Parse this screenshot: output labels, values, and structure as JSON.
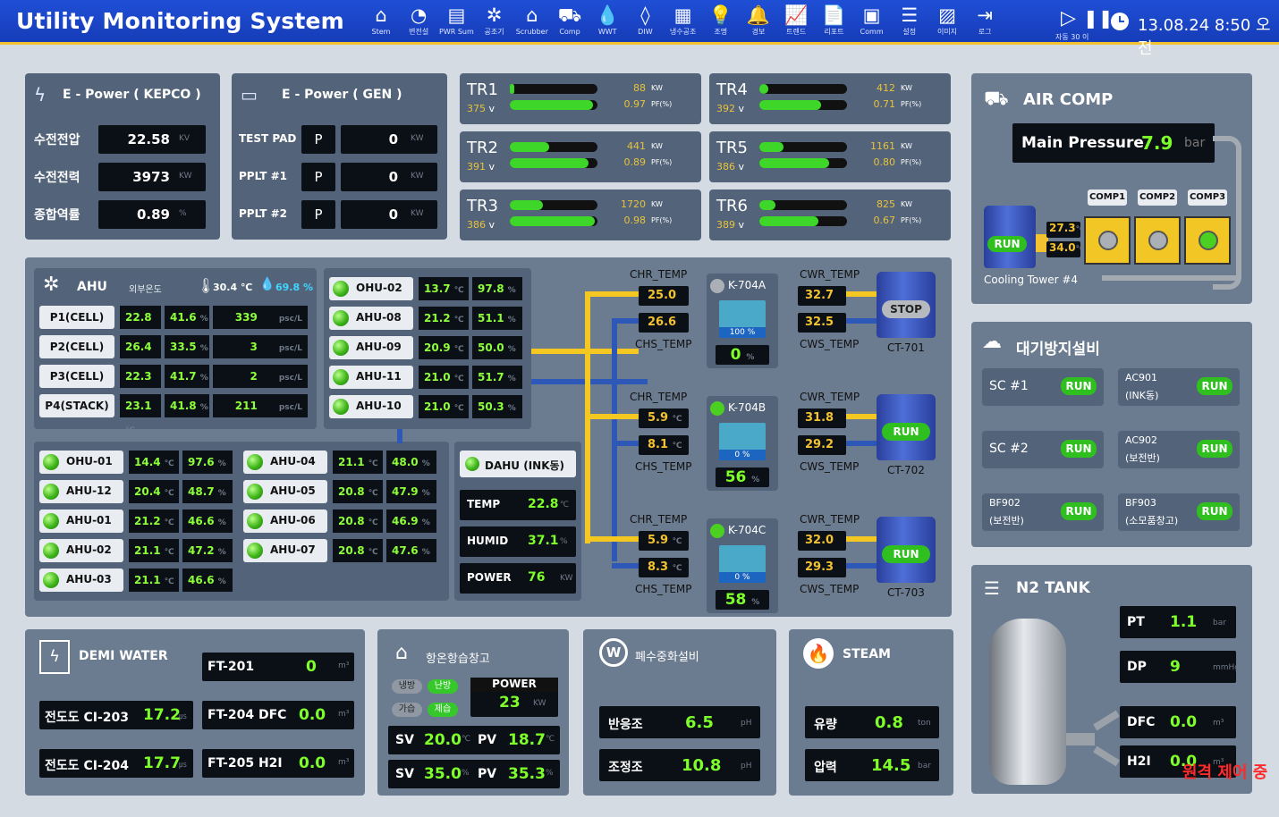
{
  "header": {
    "title": "Utility Monitoring System",
    "datetime": "13.08.24  8:50 오전",
    "nav": [
      {
        "icon": "home-icon",
        "glyph": "⌂",
        "label": "Stem"
      },
      {
        "icon": "gauge-icon",
        "glyph": "◔",
        "label": "변전설"
      },
      {
        "icon": "printer-icon",
        "glyph": "▤",
        "label": "PWR Sum"
      },
      {
        "icon": "fan-icon",
        "glyph": "✲",
        "label": "공조기"
      },
      {
        "icon": "factory-icon",
        "glyph": "⌂",
        "label": "Scrubber"
      },
      {
        "icon": "compressor-icon",
        "glyph": "⛟",
        "label": "Comp"
      },
      {
        "icon": "water-drop-icon",
        "glyph": "💧",
        "label": "WWT"
      },
      {
        "icon": "deionized-water-icon",
        "glyph": "◊",
        "label": "DIW"
      },
      {
        "icon": "chiller-icon",
        "glyph": "▦",
        "label": "냉수공조"
      },
      {
        "icon": "bulb-icon",
        "glyph": "💡",
        "label": "조명"
      },
      {
        "icon": "alarm-bell-icon",
        "glyph": "🔔",
        "label": "경보"
      },
      {
        "icon": "trend-chart-icon",
        "glyph": "📈",
        "label": "트렌드"
      },
      {
        "icon": "document-icon",
        "glyph": "📄",
        "label": "리포트"
      },
      {
        "icon": "monitor-icon",
        "glyph": "▣",
        "label": "Comm"
      },
      {
        "icon": "settings-sliders-icon",
        "glyph": "☰",
        "label": "설정"
      },
      {
        "icon": "image-icon",
        "glyph": "▨",
        "label": "이미지"
      },
      {
        "icon": "logout-icon",
        "glyph": "⇥",
        "label": "로그"
      }
    ],
    "play_label": "자동 30 이"
  },
  "kepco": {
    "title": "E - Power ( KEPCO )",
    "rows": [
      {
        "label": "수전전압",
        "value": "22.58",
        "unit": "KV"
      },
      {
        "label": "수전전력",
        "value": "3973",
        "unit": "KW"
      },
      {
        "label": "종합역률",
        "value": "0.89",
        "unit": "%"
      }
    ]
  },
  "gen": {
    "title": "E - Power ( GEN )",
    "rows": [
      {
        "label": "TEST PAD",
        "mode": "P",
        "value": "0",
        "unit": "KW"
      },
      {
        "label": "PPLT #1",
        "mode": "P",
        "value": "0",
        "unit": "KW"
      },
      {
        "label": "PPLT #2",
        "mode": "P",
        "value": "0",
        "unit": "KW"
      }
    ]
  },
  "tr": [
    {
      "name": "TR1",
      "volt": "375",
      "kw": "88",
      "pf": "0.97",
      "f1": 0.05,
      "f2": 0.95
    },
    {
      "name": "TR2",
      "volt": "391",
      "kw": "441",
      "pf": "0.89",
      "f1": 0.45,
      "f2": 0.9
    },
    {
      "name": "TR3",
      "volt": "386",
      "kw": "1720",
      "pf": "0.98",
      "f1": 0.38,
      "f2": 0.97
    },
    {
      "name": "TR4",
      "volt": "392",
      "kw": "412",
      "pf": "0.71",
      "f1": 0.1,
      "f2": 0.7
    },
    {
      "name": "TR5",
      "volt": "386",
      "kw": "1161",
      "pf": "0.80",
      "f1": 0.28,
      "f2": 0.8
    },
    {
      "name": "TR6",
      "volt": "389",
      "kw": "825",
      "pf": "0.67",
      "f1": 0.18,
      "f2": 0.67
    }
  ],
  "tr_units": {
    "v": "v",
    "kw": "KW",
    "pf": "PF(%)"
  },
  "aircomp": {
    "title": "AIR COMP",
    "main_label": "Main Pressure",
    "main_value": "7.9",
    "main_unit": "bar",
    "comps": [
      "COMP1",
      "COMP2",
      "COMP3"
    ],
    "run": "RUN",
    "temp1": "27.3",
    "temp2": "34.0",
    "temp_unit": "℃",
    "tower": "Cooling Tower #4"
  },
  "ahu": {
    "title": "AHU",
    "sub": "외부온도",
    "temp": "30.4 ℃",
    "humid": "69.8 %",
    "cells": [
      {
        "label": "P1(CELL)",
        "t": "22.8",
        "h": "41.6",
        "p": "339"
      },
      {
        "label": "P2(CELL)",
        "t": "26.4",
        "h": "33.5",
        "p": "3"
      },
      {
        "label": "P3(CELL)",
        "t": "22.3",
        "h": "41.7",
        "p": "2"
      },
      {
        "label": "P4(STACK)",
        "t": "23.1",
        "h": "41.8",
        "p": "211"
      }
    ],
    "tu": "℃",
    "hu": "%",
    "pu": "psc/L"
  },
  "ahu_list1": [
    {
      "name": "OHU-02",
      "t": "13.7",
      "h": "97.8"
    },
    {
      "name": "AHU-08",
      "t": "21.2",
      "h": "51.1"
    },
    {
      "name": "AHU-09",
      "t": "20.9",
      "h": "50.0"
    },
    {
      "name": "AHU-11",
      "t": "21.0",
      "h": "51.7"
    },
    {
      "name": "AHU-10",
      "t": "21.0",
      "h": "50.3"
    }
  ],
  "ahu_list2": [
    {
      "name": "OHU-01",
      "t": "14.4",
      "h": "97.6"
    },
    {
      "name": "AHU-12",
      "t": "20.4",
      "h": "48.7"
    },
    {
      "name": "AHU-01",
      "t": "21.2",
      "h": "46.6"
    },
    {
      "name": "AHU-02",
      "t": "21.1",
      "h": "47.2"
    },
    {
      "name": "AHU-03",
      "t": "21.1",
      "h": "46.6"
    }
  ],
  "ahu_list3": [
    {
      "name": "AHU-04",
      "t": "21.1",
      "h": "48.0"
    },
    {
      "name": "AHU-05",
      "t": "20.8",
      "h": "47.9"
    },
    {
      "name": "AHU-06",
      "t": "20.8",
      "h": "46.9"
    },
    {
      "name": "AHU-07",
      "t": "20.8",
      "h": "47.6"
    }
  ],
  "dahu": {
    "title": "DAHU (INK동)",
    "rows": [
      {
        "label": "TEMP",
        "value": "22.8",
        "unit": "℃"
      },
      {
        "label": "HUMID",
        "value": "37.1",
        "unit": "%"
      },
      {
        "label": "POWER",
        "value": "76",
        "unit": "KW"
      }
    ]
  },
  "chillers": [
    {
      "chr": "25.0",
      "chs": "26.6",
      "cwr": "32.7",
      "cws": "32.5",
      "name": "K-704A",
      "pct": "100 %",
      "load": "0",
      "ct": "CT-701",
      "state": "STOP"
    },
    {
      "chr": "5.9",
      "chs": "8.1",
      "cwr": "31.8",
      "cws": "29.2",
      "name": "K-704B",
      "pct": "0 %",
      "load": "56",
      "ct": "CT-702",
      "state": "RUN"
    },
    {
      "chr": "5.9",
      "chs": "8.3",
      "cwr": "32.0",
      "cws": "29.3",
      "name": "K-704C",
      "pct": "0 %",
      "load": "58",
      "ct": "CT-703",
      "state": "RUN"
    }
  ],
  "ch_labels": {
    "chr": "CHR_TEMP",
    "chs": "CHS_TEMP",
    "cwr": "CWR_TEMP",
    "cws": "CWS_TEMP",
    "unit": "℃",
    "pu": "%"
  },
  "scrubber": {
    "title": "대기방지설비",
    "items": [
      {
        "l1": "SC #1",
        "l2": "",
        "s": "RUN"
      },
      {
        "l1": "AC901",
        "l2": "(INK동)",
        "s": "RUN"
      },
      {
        "l1": "SC #2",
        "l2": "",
        "s": "RUN"
      },
      {
        "l1": "AC902",
        "l2": "(보전반)",
        "s": "RUN"
      },
      {
        "l1": "BF902",
        "l2": "(보전반)",
        "s": "RUN"
      },
      {
        "l1": "BF903",
        "l2": "(소모품창고)",
        "s": "RUN"
      }
    ]
  },
  "demi": {
    "title": "DEMI WATER",
    "ft201_label": "FT-201",
    "ft201": "0",
    "ft201_unit": "m³",
    "ci203_label": "전도도 CI-203",
    "ci203": "17.2",
    "ci_unit": "㎲",
    "ft204_label": "FT-204 DFC",
    "ft204": "0.0",
    "ci204_label": "전도도 CI-204",
    "ci204": "17.7",
    "ft205_label": "FT-205 H2I",
    "ft205": "0.0",
    "m3": "m³"
  },
  "hvac": {
    "title": "항온항습창고",
    "m1": "냉방",
    "m2": "난방",
    "m3": "가습",
    "m4": "제습",
    "power_label": "POWER",
    "power": "23",
    "power_unit": "KW",
    "sv1": "20.0",
    "pv1": "18.7",
    "sv2": "35.0",
    "pv2": "35.3",
    "sv": "SV",
    "pv": "PV",
    "tu": "℃",
    "hu": "%"
  },
  "waste": {
    "title": "폐수중화설비",
    "r1_label": "반응조",
    "r1": "6.5",
    "r2_label": "조정조",
    "r2": "10.8",
    "unit": "pH"
  },
  "steam": {
    "title": "STEAM",
    "r1_label": "유량",
    "r1": "0.8",
    "r1_unit": "ton",
    "r2_label": "압력",
    "r2": "14.5",
    "r2_unit": "bar"
  },
  "n2": {
    "title": "N2 TANK",
    "rows": [
      {
        "label": "PT",
        "value": "1.1",
        "unit": "bar"
      },
      {
        "label": "DP",
        "value": "9",
        "unit": "mmHg"
      },
      {
        "label": "DFC",
        "value": "0.0",
        "unit": "m³"
      },
      {
        "label": "H2I",
        "value": "0.0",
        "unit": "m³"
      }
    ]
  },
  "remote": "원격 제어 중",
  "colors": {
    "header": "#1f4fd6",
    "accent": "#f2c230",
    "panel": "#53647a",
    "value_green": "#7dff2a",
    "pipe_yellow": "#f4c721",
    "pipe_blue": "#2d58b8"
  }
}
